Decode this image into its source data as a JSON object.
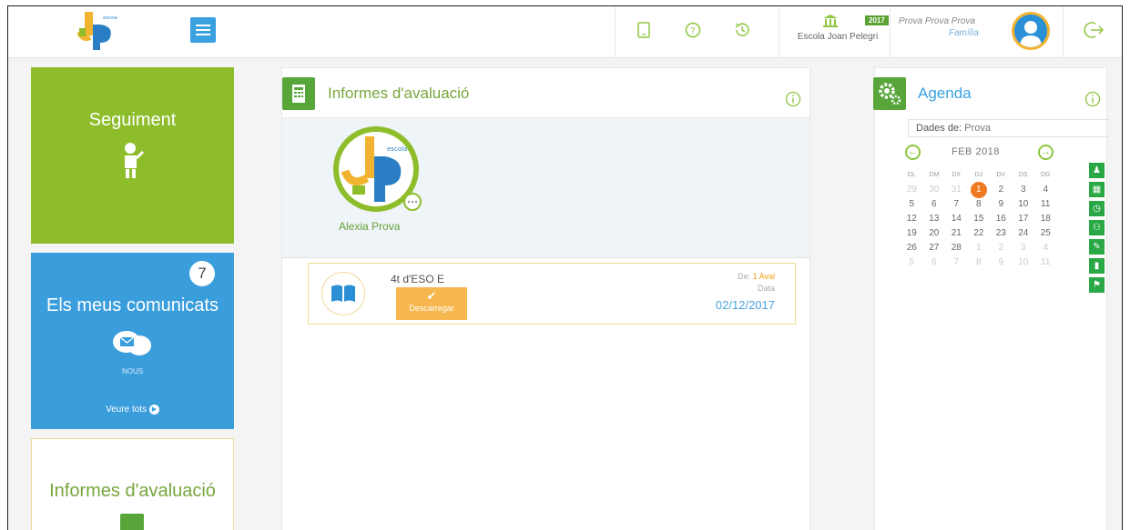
{
  "header": {
    "school_name": "Escola Joan Pelegri",
    "year_badge": "2017",
    "user_name": "Prova Prova Prova",
    "user_role": "Família"
  },
  "tiles": {
    "seguiment": {
      "title": "Seguiment"
    },
    "comunicats": {
      "title": "Els meus comunicats",
      "count": "7",
      "status": "NOUS",
      "link": "Veure tots"
    },
    "informes": {
      "title": "Informes d'avaluació"
    }
  },
  "center": {
    "title": "Informes d'avaluació",
    "student_name": "Alexia Prova",
    "report": {
      "course": "4t d'ESO E",
      "download_label": "Descarregar",
      "de_prefix": "De:",
      "de_value": "1 Aval",
      "data_label": "Data",
      "date": "02/12/2017"
    }
  },
  "agenda": {
    "title": "Agenda",
    "dades_label": "Dades de:",
    "dades_value": "Prova",
    "month": "FEB 2018",
    "weekdays": [
      "DL",
      "DM",
      "DX",
      "DJ",
      "DV",
      "DS",
      "DG"
    ],
    "weeks": [
      [
        [
          "29",
          "muted"
        ],
        [
          "30",
          "muted"
        ],
        [
          "31",
          "muted"
        ],
        [
          "1",
          "today"
        ],
        [
          "2",
          ""
        ],
        [
          "3",
          ""
        ],
        [
          "4",
          ""
        ]
      ],
      [
        [
          "5",
          ""
        ],
        [
          "6",
          ""
        ],
        [
          "7",
          ""
        ],
        [
          "8",
          ""
        ],
        [
          "9",
          ""
        ],
        [
          "10",
          ""
        ],
        [
          "11",
          ""
        ]
      ],
      [
        [
          "12",
          ""
        ],
        [
          "13",
          ""
        ],
        [
          "14",
          ""
        ],
        [
          "15",
          ""
        ],
        [
          "16",
          ""
        ],
        [
          "17",
          ""
        ],
        [
          "18",
          ""
        ]
      ],
      [
        [
          "19",
          ""
        ],
        [
          "20",
          ""
        ],
        [
          "21",
          ""
        ],
        [
          "22",
          ""
        ],
        [
          "23",
          ""
        ],
        [
          "24",
          ""
        ],
        [
          "25",
          ""
        ]
      ],
      [
        [
          "26",
          ""
        ],
        [
          "27",
          ""
        ],
        [
          "28",
          ""
        ],
        [
          "1",
          "muted"
        ],
        [
          "2",
          "muted"
        ],
        [
          "3",
          "muted"
        ],
        [
          "4",
          "muted"
        ]
      ],
      [
        [
          "5",
          "muted"
        ],
        [
          "6",
          "muted"
        ],
        [
          "7",
          "muted"
        ],
        [
          "8",
          "muted"
        ],
        [
          "9",
          "muted"
        ],
        [
          "10",
          "muted"
        ],
        [
          "11",
          "muted"
        ]
      ]
    ],
    "tools": [
      "person-icon",
      "calendar-icon",
      "clock-icon",
      "group-icon",
      "pencil-icon",
      "chart-icon",
      "flag-icon"
    ]
  },
  "colors": {
    "green_tile": "#8ebd2b",
    "blue_tile": "#3a9ddc",
    "orange_accent": "#f6b74e",
    "today": "#f07a22"
  }
}
